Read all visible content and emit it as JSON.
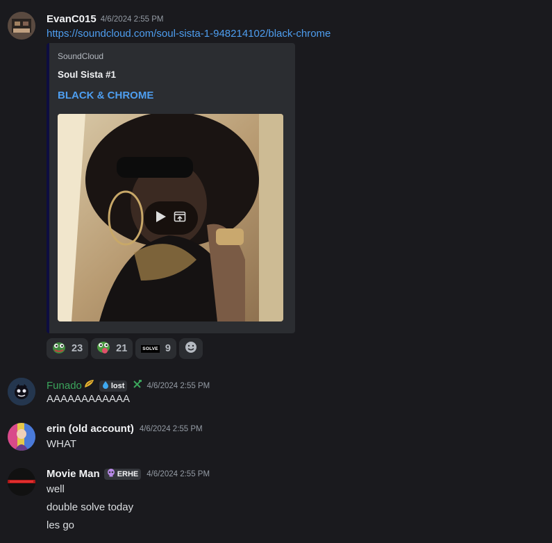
{
  "messages": [
    {
      "author": "EvanC015",
      "timestamp": "4/6/2024 2:55 PM",
      "link": "https://soundcloud.com/soul-sista-1-948214102/black-chrome",
      "embed": {
        "provider": "SoundCloud",
        "author": "Soul Sista #1",
        "title": "BLACK & CHROME",
        "accent_color": "#0d0d40"
      },
      "reactions": [
        {
          "icon": "pepe-emoji",
          "count": "23"
        },
        {
          "icon": "pepe-tongue-emoji",
          "count": "21"
        },
        {
          "icon": "solve-emoji",
          "label": "SOLVE",
          "count": "9"
        }
      ]
    },
    {
      "author": "Funado",
      "author_color": "#3ba55c",
      "badge": "lost",
      "timestamp": "4/6/2024 2:55 PM",
      "lines": [
        "AAAAAAAAAAAA"
      ]
    },
    {
      "author": "erin (old account)",
      "timestamp": "4/6/2024 2:55 PM",
      "lines": [
        "WHAT"
      ]
    },
    {
      "author": "Movie Man",
      "badge": "ERHE",
      "timestamp": "4/6/2024 2:55 PM",
      "lines": [
        "well",
        "double solve today",
        "les go"
      ]
    }
  ]
}
